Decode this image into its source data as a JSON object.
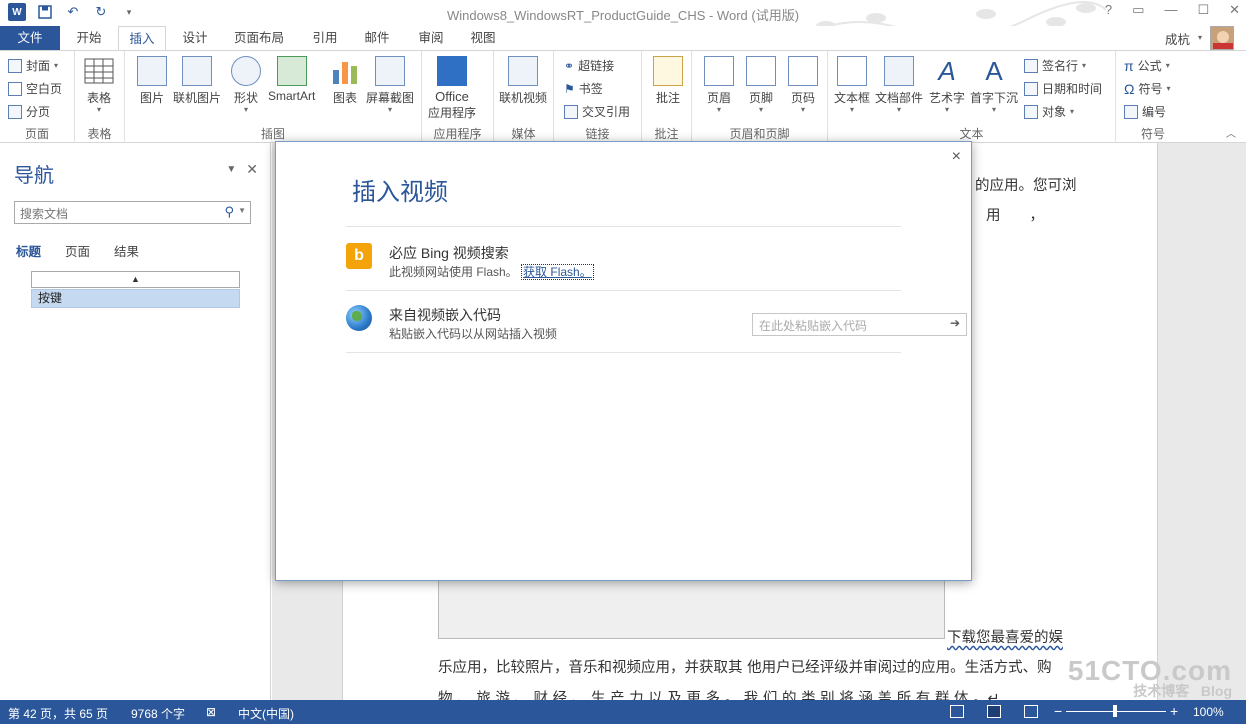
{
  "title_bar": {
    "title": "Windows8_WindowsRT_ProductGuide_CHS - Word (试用版)",
    "qat_icons": [
      "word-logo",
      "save-icon",
      "undo-icon",
      "redo-icon",
      "customize-icon"
    ],
    "word_badge": "W",
    "controls": {
      "help": "?",
      "ribbon_options": "▭",
      "minimize": "—",
      "maximize": "☐",
      "close": "✕"
    }
  },
  "tabs": [
    "文件",
    "开始",
    "插入",
    "设计",
    "页面布局",
    "引用",
    "邮件",
    "审阅",
    "视图"
  ],
  "active_tab": "插入",
  "user": {
    "name": "成杭"
  },
  "ribbon": {
    "pages": {
      "label": "页面",
      "items": [
        "封面",
        "空白页",
        "分页"
      ]
    },
    "tables": {
      "label": "表格",
      "item": "表格"
    },
    "illustrations": {
      "label": "插图",
      "items": [
        "图片",
        "联机图片",
        "形状",
        "SmartArt",
        "图表",
        "屏幕截图"
      ]
    },
    "apps": {
      "label": "应用程序",
      "item_line1": "Office",
      "item_line2": "应用程序"
    },
    "media": {
      "label": "媒体",
      "item": "联机视频"
    },
    "links": {
      "label": "链接",
      "items": [
        "超链接",
        "书签",
        "交叉引用"
      ]
    },
    "comments": {
      "label": "批注",
      "item": "批注"
    },
    "header_footer": {
      "label": "页眉和页脚",
      "items": [
        "页眉",
        "页脚",
        "页码"
      ]
    },
    "text": {
      "label": "文本",
      "items": [
        "文本框",
        "文档部件",
        "艺术字",
        "首字下沉"
      ],
      "small": [
        "签名行",
        "日期和时间",
        "对象"
      ]
    },
    "symbols": {
      "label": "符号",
      "items": [
        "公式",
        "符号",
        "编号"
      ]
    }
  },
  "nav": {
    "title": "导航",
    "search_placeholder": "搜索文档",
    "tabs": [
      "标题",
      "页面",
      "结果"
    ],
    "active_tab": "标题",
    "outline_items": [
      "按键"
    ]
  },
  "document": {
    "line1_tail": "的应用。您可浏",
    "line2_tail": "用　　，",
    "line3_tail": "下载您最喜爱的娱",
    "line4": "乐应用，比较照片，音乐和视频应用，并获取其 他用户已经评级并审阅过的应用。生活方式、购",
    "line5": "物 、 旅 游 、 财 经 、 生 产 力 以 及 更 多 。 我 们 的 类 别 将 涵 盖 所 有 群 体 。↵"
  },
  "dialog": {
    "title": "插入视频",
    "close": "×",
    "sources": [
      {
        "title": "必应 Bing 视频搜索",
        "subtitle": "此视频网站使用 Flash。",
        "link": "获取 Flash。",
        "icon": "bing-icon"
      },
      {
        "title": "来自视频嵌入代码",
        "subtitle": "粘贴嵌入代码以从网站插入视频",
        "input_placeholder": "在此处粘贴嵌入代码",
        "icon": "globe-icon"
      }
    ]
  },
  "status": {
    "page": "第 42 页，共 65 页",
    "words": "9768 个字",
    "language": "中文(中国)",
    "zoom": "100%",
    "zoom_minus": "−",
    "zoom_plus": "+"
  },
  "watermark": {
    "line1": "51CTO.com",
    "line2": "技术博客",
    "line3": "Blog"
  },
  "colors": {
    "accent": "#2b579a",
    "bing": "#f4a30b",
    "nav_selected": "#c5d9f1"
  }
}
